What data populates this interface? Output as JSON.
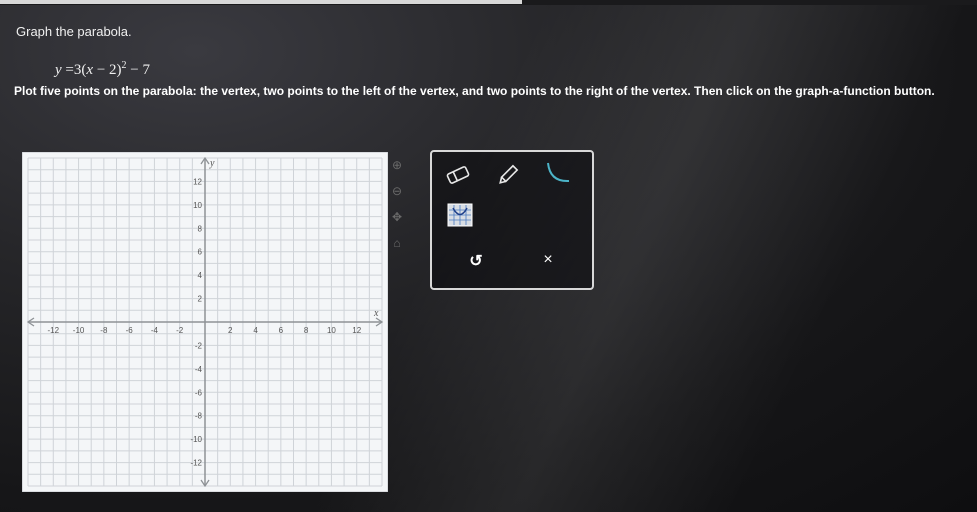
{
  "prompt": "Graph the parabola.",
  "equation": {
    "lhs": "y",
    "eq": "=",
    "coef": "3",
    "open": "(",
    "var": "x",
    "minus": " − ",
    "h": "2",
    "close": ")",
    "exp": "2",
    "tail": " − 7"
  },
  "instruction": "Plot five points on the parabola: the vertex, two points to the left of the vertex, and two points to the right of the vertex. Then click on the graph-a-function button.",
  "graph": {
    "x_axis_label": "x",
    "y_axis_label": "y",
    "x_tick_labels": [
      "-12",
      "-10",
      "-8",
      "-6",
      "-4",
      "-2",
      "2",
      "4",
      "6",
      "8",
      "10",
      "12"
    ],
    "y_tick_labels": [
      "12",
      "10",
      "8",
      "6",
      "4",
      "2",
      "-2",
      "-4",
      "-6",
      "-8",
      "-10",
      "-12"
    ],
    "range": [
      -14,
      14
    ]
  },
  "side_icons": [
    "zoom-in-icon",
    "zoom-out-icon",
    "move-icon",
    "home-icon"
  ],
  "toolbox": {
    "tools": [
      "eraser-icon",
      "pencil-icon",
      "parabola-curve-icon",
      "graph-a-function-icon",
      "undo-icon",
      "clear-icon"
    ],
    "undo_label": "↺",
    "clear_label": "×"
  },
  "colors": {
    "tool_accent": "#4cb4c8",
    "grid_line": "#cfd3d8",
    "axis": "#8e9296"
  }
}
